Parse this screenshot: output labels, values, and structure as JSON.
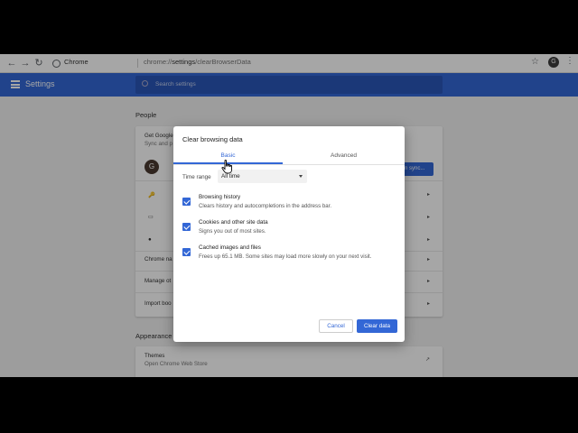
{
  "toolbar": {
    "site_name": "Chrome",
    "url_scheme": "chrome://",
    "url_host": "settings",
    "url_path": "/clearBrowserData",
    "profile_initial": "G"
  },
  "settings_header": {
    "title": "Settings",
    "search_placeholder": "Search settings"
  },
  "background": {
    "section_people": "People",
    "get_google": "Get Google",
    "sync_and": "Sync and p",
    "avatar_initial": "G",
    "sync_button": "n sync...",
    "chrome_name": "Chrome na",
    "manage": "Manage ot",
    "import": "Import boo",
    "section_appearance": "Appearance",
    "themes": "Themes",
    "themes_sub": "Open Chrome Web Store"
  },
  "dialog": {
    "title": "Clear browsing data",
    "tabs": [
      {
        "label": "Basic",
        "active": true
      },
      {
        "label": "Advanced",
        "active": false
      }
    ],
    "time_range_label": "Time range",
    "time_range_value": "All time",
    "options": [
      {
        "title": "Browsing history",
        "description": "Clears history and autocompletions in the address bar.",
        "checked": true
      },
      {
        "title": "Cookies and other site data",
        "description": "Signs you out of most sites.",
        "checked": true
      },
      {
        "title": "Cached images and files",
        "description": "Frees up 65.1 MB. Some sites may load more slowly on your next visit.",
        "checked": true
      }
    ],
    "cancel_label": "Cancel",
    "clear_label": "Clear data"
  },
  "colors": {
    "accent": "#3367d6"
  }
}
